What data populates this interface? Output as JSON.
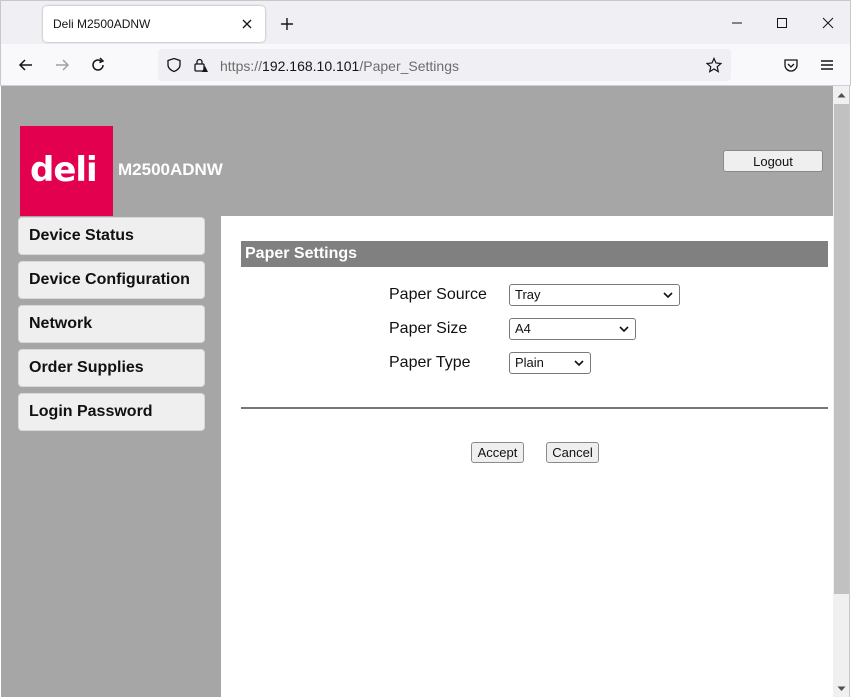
{
  "browser": {
    "tab_title": "Deli M2500ADNW",
    "url_prefix": "https://",
    "url_host": "192.168.10.101",
    "url_path": "/Paper_Settings"
  },
  "header": {
    "logo_text": "deli",
    "model_name": "M2500ADNW",
    "logout_label": "Logout"
  },
  "sidebar": {
    "items": [
      {
        "label": "Device Status"
      },
      {
        "label": "Device Configuration"
      },
      {
        "label": "Network"
      },
      {
        "label": "Order Supplies"
      },
      {
        "label": "Login Password"
      }
    ]
  },
  "main": {
    "section_title": "Paper Settings",
    "fields": [
      {
        "label": "Paper Source",
        "value": "Tray"
      },
      {
        "label": "Paper Size",
        "value": "A4"
      },
      {
        "label": "Paper Type",
        "value": "Plain"
      }
    ],
    "accept_label": "Accept",
    "cancel_label": "Cancel"
  },
  "colors": {
    "brand": "#e3004f",
    "page_background": "#a6a6a6",
    "section_header": "#808080"
  },
  "icons": [
    "close-icon",
    "plus-icon",
    "minimize-icon",
    "maximize-icon",
    "back-arrow-icon",
    "forward-arrow-icon",
    "reload-icon",
    "shield-icon",
    "lock-icon",
    "star-icon",
    "pocket-icon",
    "menu-icon",
    "chevron-down-icon"
  ]
}
